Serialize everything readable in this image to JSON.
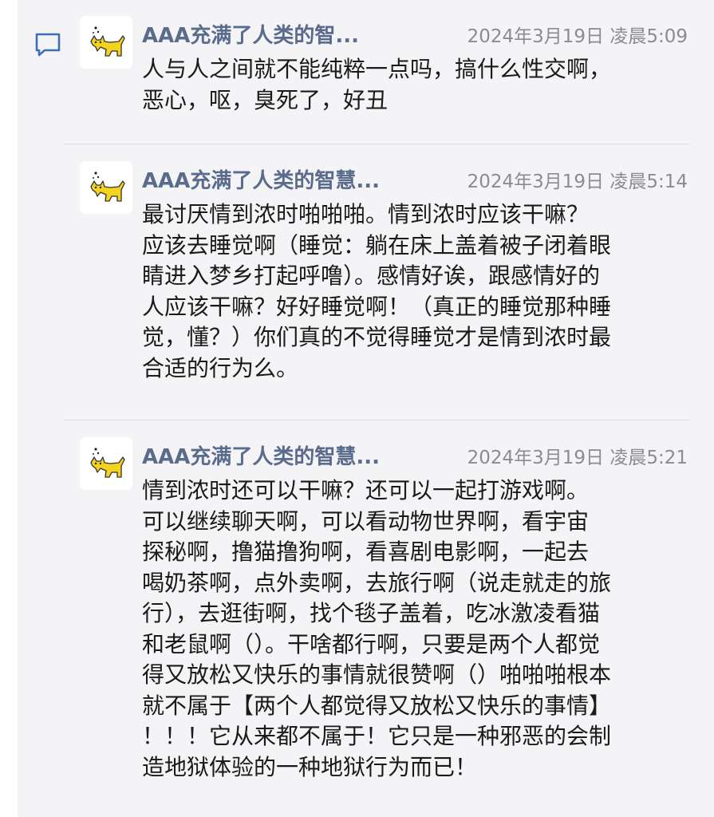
{
  "thread": {
    "icon": "comment-bubble-icon",
    "accent_color": "#3d6fb6",
    "messages": [
      {
        "avatar_icon": "yellow-cat-avatar-icon",
        "sender": "AAA充满了人类的智...",
        "timestamp": "2024年3月19日 凌晨5:09",
        "lines": [
          "人与人之间就不能纯粹一点吗，搞什么性交啊，",
          "恶心，呕，臭死了，好丑"
        ]
      },
      {
        "avatar_icon": "yellow-cat-avatar-icon",
        "sender": "AAA充满了人类的智慧...",
        "timestamp": "2024年3月19日 凌晨5:14",
        "lines": [
          "最讨厌情到浓时啪啪啪。情到浓时应该干嘛？",
          "应该去睡觉啊（睡觉：躺在床上盖着被子闭着眼",
          "睛进入梦乡打起呼噜）。感情好诶，跟感情好的",
          "人应该干嘛？好好睡觉啊！（真正的睡觉那种睡",
          "觉，懂？）你们真的不觉得睡觉才是情到浓时最",
          "合适的行为么。"
        ]
      },
      {
        "avatar_icon": "yellow-cat-avatar-icon",
        "sender": "AAA充满了人类的智慧...",
        "timestamp": "2024年3月19日 凌晨5:21",
        "lines": [
          "情到浓时还可以干嘛？还可以一起打游戏啊。",
          "可以继续聊天啊，可以看动物世界啊，看宇宙",
          "探秘啊，撸猫撸狗啊，看喜剧电影啊，一起去",
          "喝奶茶啊，点外卖啊，去旅行啊（说走就走的旅",
          "行），去逛街啊，找个毯子盖着，吃冰激凌看猫",
          "和老鼠啊（）。干啥都行啊，只要是两个人都觉",
          "得又放松又快乐的事情就很赞啊（）啪啪啪根本",
          "就不属于【两个人都觉得又放松又快乐的事情】",
          "！！！它从来都不属于！它只是一种邪恶的会制",
          "造地狱体验的一种地狱行为而已！"
        ]
      }
    ]
  }
}
